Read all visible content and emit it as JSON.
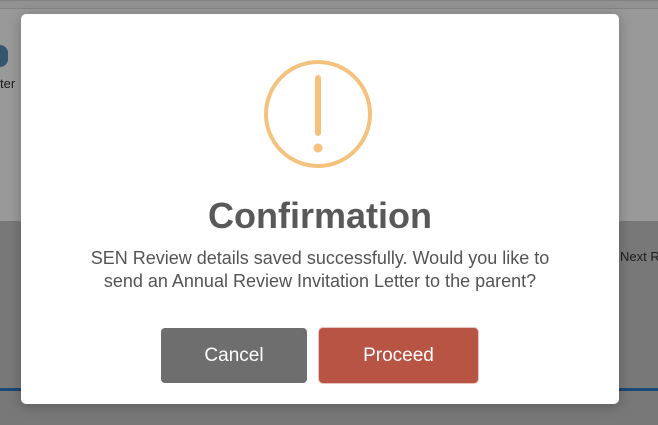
{
  "background": {
    "left_text": "ter",
    "right_text": "Next R"
  },
  "dialog": {
    "icon": "exclamation-circle-icon",
    "icon_color": "#f5c27d",
    "title": "Confirmation",
    "message_line1": "SEN Review details saved successfully. Would you like to",
    "message_line2": "send an Annual Review Invitation Letter to the parent?",
    "cancel_label": "Cancel",
    "proceed_label": "Proceed",
    "cancel_color": "#6e6e6e",
    "proceed_color": "#b75443"
  }
}
